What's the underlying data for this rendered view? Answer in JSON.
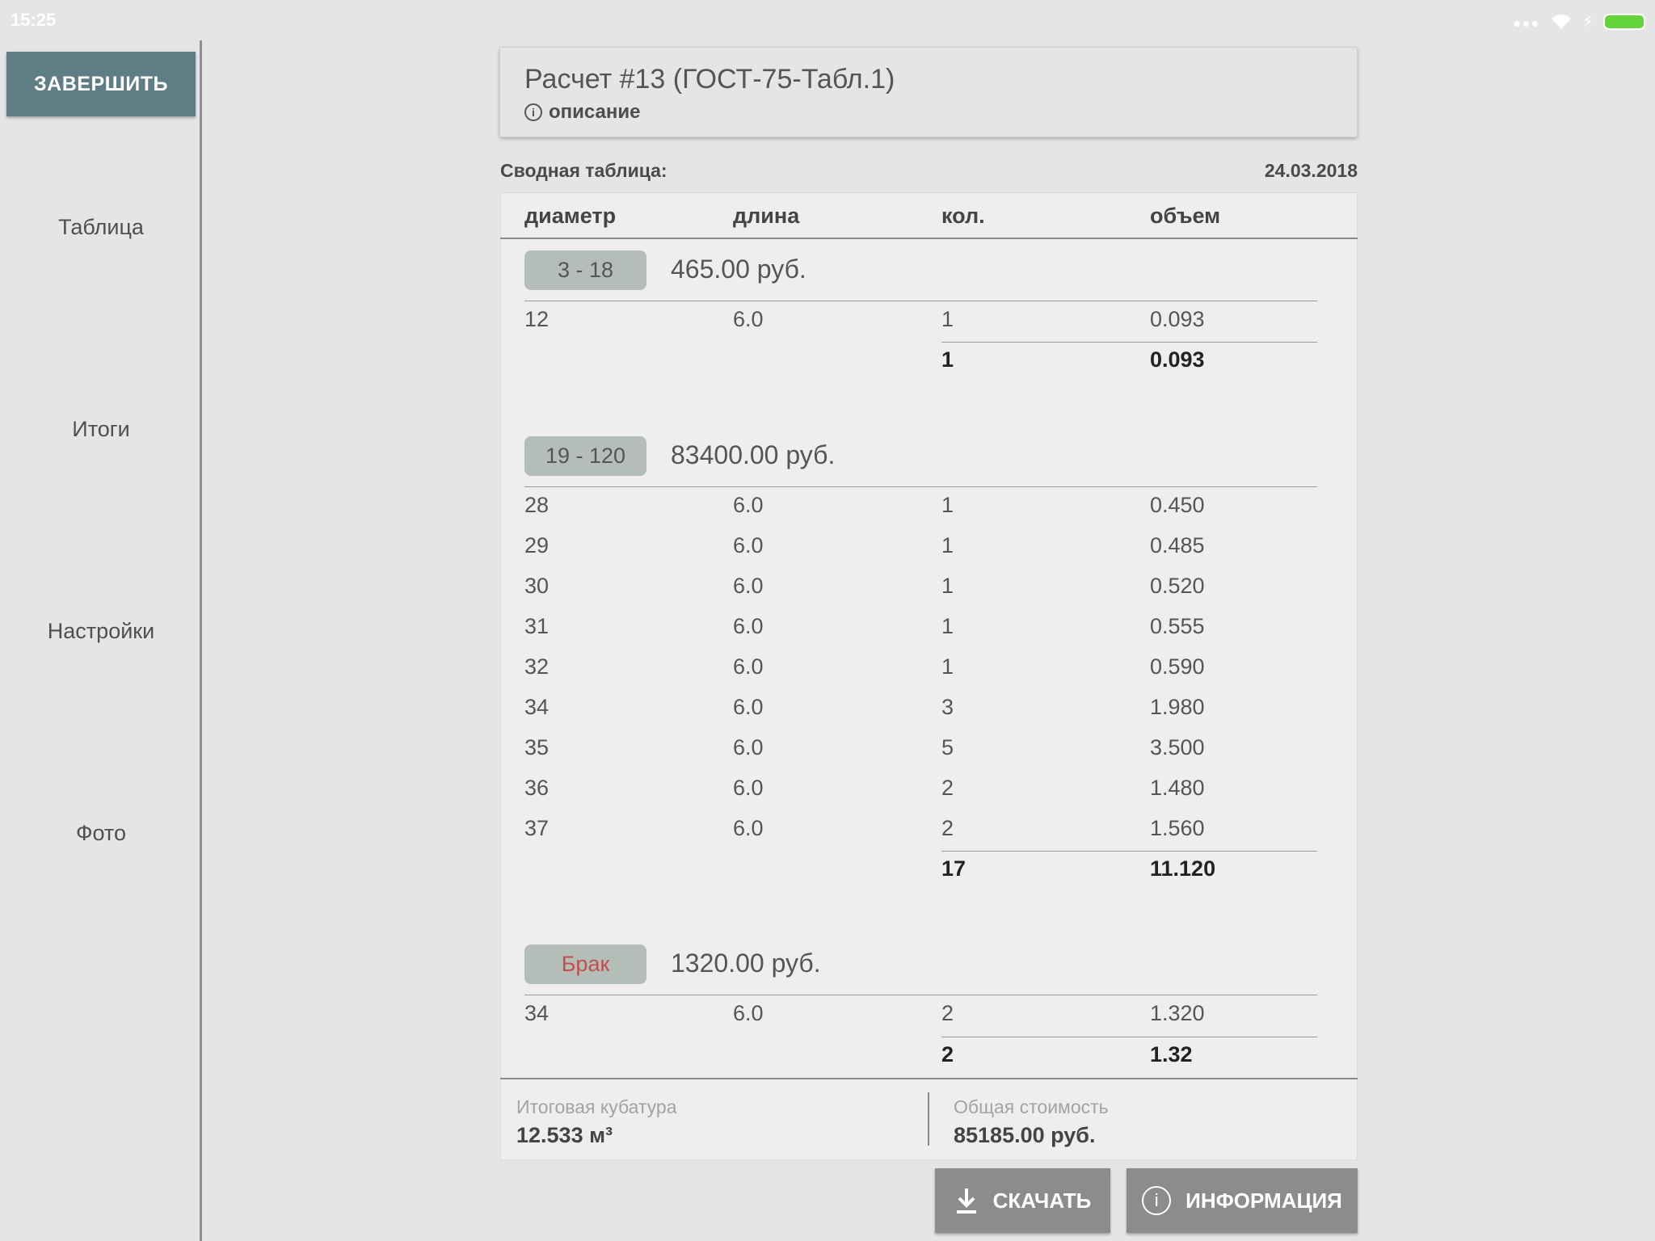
{
  "status_bar": {
    "time": "15:25"
  },
  "sidebar": {
    "finish_label": "ЗАВЕРШИТЬ",
    "items": [
      {
        "label": "Таблица"
      },
      {
        "label": "Итоги"
      },
      {
        "label": "Настройки"
      },
      {
        "label": "Фото"
      }
    ]
  },
  "header": {
    "title": "Расчет #13 (ГОСТ-75-Табл.1)",
    "description_label": "описание"
  },
  "summary": {
    "label": "Сводная таблица:",
    "date": "24.03.2018"
  },
  "table": {
    "columns": [
      "диаметр",
      "длина",
      "кол.",
      "объем"
    ],
    "groups": [
      {
        "range": "3 - 18",
        "price": "465.00 руб.",
        "rows": [
          {
            "diameter": "12",
            "length": "6.0",
            "count": "1",
            "volume": "0.093"
          }
        ],
        "total_count": "1",
        "total_volume": "0.093"
      },
      {
        "range": "19 - 120",
        "price": "83400.00 руб.",
        "rows": [
          {
            "diameter": "28",
            "length": "6.0",
            "count": "1",
            "volume": "0.450"
          },
          {
            "diameter": "29",
            "length": "6.0",
            "count": "1",
            "volume": "0.485"
          },
          {
            "diameter": "30",
            "length": "6.0",
            "count": "1",
            "volume": "0.520"
          },
          {
            "diameter": "31",
            "length": "6.0",
            "count": "1",
            "volume": "0.555"
          },
          {
            "diameter": "32",
            "length": "6.0",
            "count": "1",
            "volume": "0.590"
          },
          {
            "diameter": "34",
            "length": "6.0",
            "count": "3",
            "volume": "1.980"
          },
          {
            "diameter": "35",
            "length": "6.0",
            "count": "5",
            "volume": "3.500"
          },
          {
            "diameter": "36",
            "length": "6.0",
            "count": "2",
            "volume": "1.480"
          },
          {
            "diameter": "37",
            "length": "6.0",
            "count": "2",
            "volume": "1.560"
          }
        ],
        "total_count": "17",
        "total_volume": "11.120"
      },
      {
        "range": "Брак",
        "range_color": "#c0504d",
        "price": "1320.00 руб.",
        "rows": [
          {
            "diameter": "34",
            "length": "6.0",
            "count": "2",
            "volume": "1.320"
          }
        ],
        "total_count": "2",
        "total_volume": "1.32"
      }
    ]
  },
  "footer": {
    "volume_label": "Итоговая кубатура",
    "volume_value": "12.533 м³",
    "cost_label": "Общая стоимость",
    "cost_value": "85185.00 руб."
  },
  "actions": {
    "download_label": "СКАЧАТЬ",
    "info_label": "ИНФОРМАЦИЯ"
  },
  "colors": {
    "accent": "#5f7d85",
    "chip": "#b5bdb8",
    "button": "#8c8c8c",
    "battery": "#63d43a"
  }
}
